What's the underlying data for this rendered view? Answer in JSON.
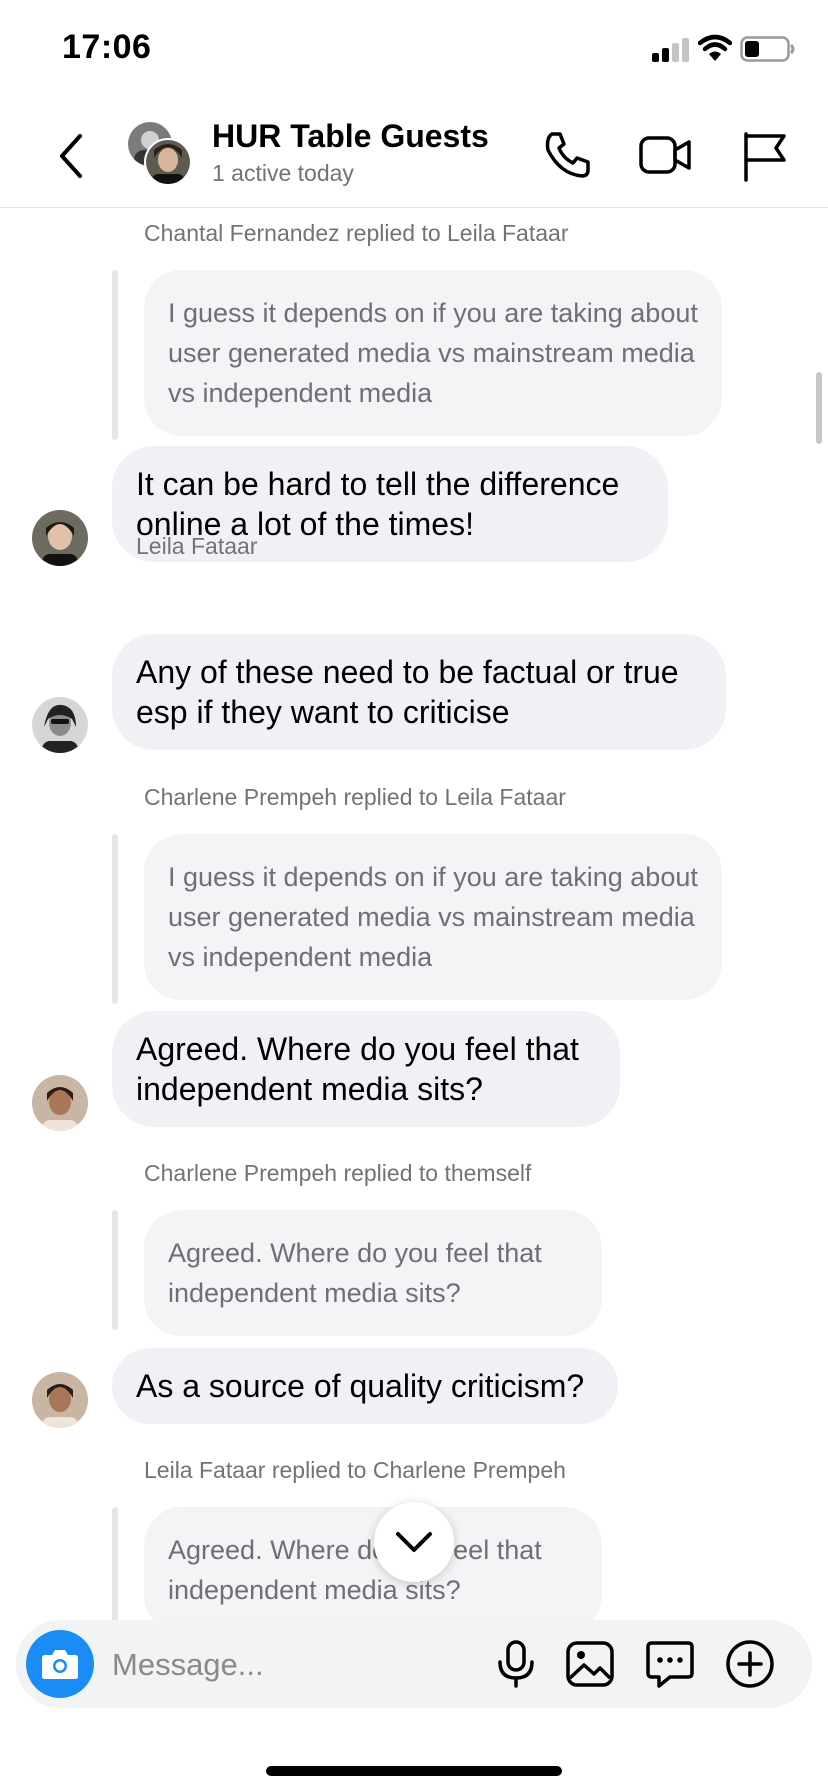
{
  "status_bar": {
    "time": "17:06"
  },
  "header": {
    "title": "HUR Table Guests",
    "subtitle": "1 active today",
    "icons": [
      "back-chevron-icon",
      "phone-icon",
      "video-camera-icon",
      "flag-icon"
    ]
  },
  "messages": {
    "m1_reply_label": "Chantal Fernandez replied to Leila Fataar",
    "m1_quote": "I guess it depends on if you are taking about user generated media vs mainstream media vs independent media",
    "m1_text": "It can be hard to tell the difference online a lot of the times!",
    "m2_sender": "Leila Fataar",
    "m2_text": "Any of these need to be factual or true esp if they want to criticise",
    "m3_reply_label": "Charlene Prempeh replied to Leila Fataar",
    "m3_quote": "I guess it depends on if you are taking about user generated media vs mainstream media vs independent media",
    "m3_text": "Agreed. Where do you feel that independent media sits?",
    "m4_reply_label": "Charlene Prempeh replied to themself",
    "m4_quote": "Agreed. Where do you feel that independent media sits?",
    "m4_text": "As a source of quality criticism?",
    "m5_reply_label": "Leila Fataar replied to Charlene Prempeh",
    "m5_quote": "Agreed. Where do you feel that independent media sits?"
  },
  "composer": {
    "placeholder": "Message...",
    "icons": [
      "camera-icon",
      "microphone-icon",
      "image-icon",
      "sticker-chat-icon",
      "plus-circle-icon"
    ]
  },
  "colors": {
    "accent": "#1a8cf5",
    "bubble": "#eff1f4",
    "quoted_bubble": "#f3f4f6",
    "muted_text": "#737373"
  }
}
